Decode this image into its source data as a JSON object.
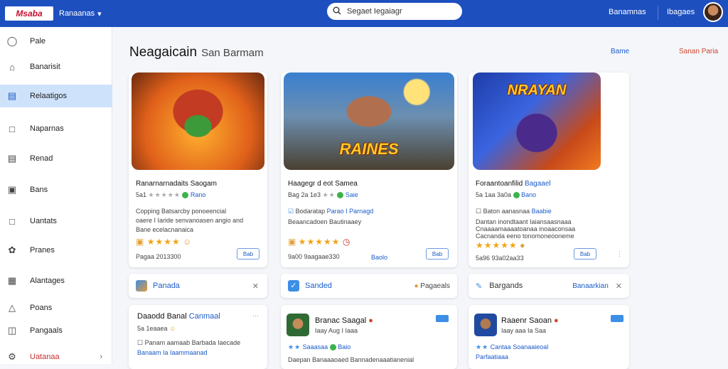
{
  "topbar": {
    "logo": "Msaba",
    "brand": "Ranaanas",
    "search_placeholder": "Segaet Iegaiagr",
    "link1": "Banamnas",
    "link2": "Ibagaes",
    "colors": {
      "bar": "#1d4fbf",
      "accent": "#c8102e"
    }
  },
  "sidebar": {
    "items": [
      {
        "label": "Pale",
        "icon": "map-pin-icon"
      },
      {
        "label": "Banarisit",
        "icon": "home-icon"
      },
      {
        "label": "Relaatigos",
        "icon": "bar-chart-icon"
      },
      {
        "label": "Naparnas",
        "icon": "phone-icon"
      },
      {
        "label": "Renad",
        "icon": "list-icon"
      },
      {
        "label": "Bans",
        "icon": "inbox-icon"
      },
      {
        "label": "Uantats",
        "icon": "document-icon"
      },
      {
        "label": "Pranes",
        "icon": "palette-icon"
      },
      {
        "label": "Alantages",
        "icon": "grid-icon"
      },
      {
        "label": "Poans",
        "icon": "user-icon"
      },
      {
        "label": "Pangaals",
        "icon": "bag-icon"
      },
      {
        "label": "Uatanaa",
        "icon": "gear-icon"
      }
    ]
  },
  "main": {
    "title": "Neagaicain",
    "subtitle": "San Barmam",
    "link_left": "Bame",
    "link_right": "Sanan Paria",
    "cards": [
      {
        "title": "Ranarnarnadaits Saogam",
        "rating_text": "5a1",
        "badge": "Rano",
        "desc1": "Copping Batsarcby ponoeencial",
        "desc2": "oaere I Iaride senvanoasen angio and",
        "desc3": "Bane ecelacnanaica",
        "price": "Pagaa 2013300",
        "btn": "Bab",
        "art_title": ""
      },
      {
        "title": "Haagegr d eot Samea",
        "rating_text": "Bag 2a 1e3",
        "badge": "Saie",
        "author": "Bodaratap",
        "author2": "Parao I Parnagd",
        "desc1": "Beaancadoen Bautinaaey",
        "price": "9a00 9aagaae330",
        "link": "Baolo",
        "btn": "Bab",
        "art_title": "RAINES"
      },
      {
        "title": "Foraantoanfilid",
        "title2": "Bagaael",
        "rating_text": "5a 1aa 3a0a",
        "badge": "Bano",
        "author": "Baton aanasnaa",
        "author2": "Baabie",
        "desc1": "Dantan inondtaant Iaiansaasnaaa",
        "desc2": "Cnaaaamaaaatoanaa inoaaconsaa",
        "desc3": "Cacnanda eeno tonomoneooneme",
        "price": "5a96 93a02aa33",
        "btn": "Bab",
        "art_title": "NRAYAN"
      }
    ],
    "tools": [
      {
        "label": "Panada",
        "icon": "tile-icon"
      },
      {
        "label": "Sanded",
        "icon": "check-icon",
        "right": "Pagaeals"
      },
      {
        "label": "Bargands",
        "icon": "wrench-icon",
        "right": "Banaarkian"
      }
    ],
    "lower": [
      {
        "title": "Daaodd Banal",
        "badge": "Canmaal",
        "rating": "5a 1eaaea",
        "author": "Panam aamaab Barbada Iaecade",
        "line2": "Banaam Ia Iaammaanad"
      },
      {
        "title": "Branac Saagal",
        "sub": "Iaay Aug I Iaaa",
        "tag": "Saaasaa",
        "tag2": "Baio",
        "line2": "Daepan Banaaaoaed Bannadenaaatianenial"
      },
      {
        "title": "Raaenr Saoan",
        "sub": "Iaay aaa Ia Saa",
        "tag": "Cantaa",
        "tag2": "Soanaaieoal",
        "line2": "Parfaatiaaa"
      }
    ]
  }
}
